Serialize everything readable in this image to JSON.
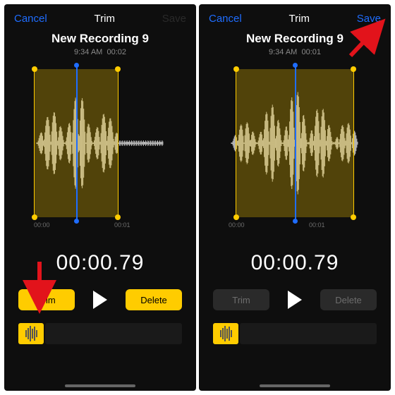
{
  "nav": {
    "cancel": "Cancel",
    "title": "Trim",
    "save": "Save"
  },
  "recording": {
    "title": "New Recording 9",
    "time": "9:34 AM"
  },
  "left": {
    "duration": "00:02",
    "timecode": "00:00.79",
    "ticks": [
      "00:00",
      "00:01"
    ],
    "trim": "Trim",
    "delete": "Delete"
  },
  "right": {
    "duration": "00:01",
    "timecode": "00:00.79",
    "ticks": [
      "00:00",
      "00:01"
    ],
    "trim": "Trim",
    "delete": "Delete"
  },
  "arrow_color": "#e2131b"
}
